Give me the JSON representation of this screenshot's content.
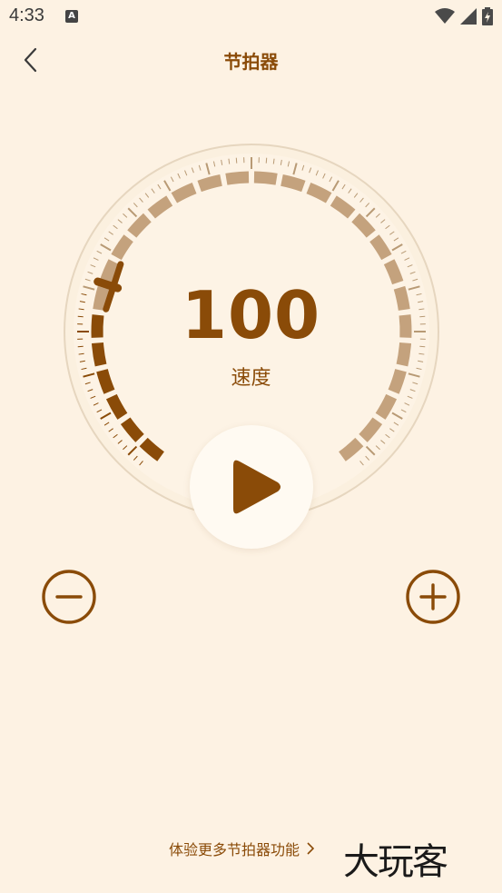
{
  "status": {
    "time": "4:33",
    "notification_icon": "A"
  },
  "header": {
    "title": "节拍器",
    "back_icon": "chevron-left-icon"
  },
  "metronome": {
    "bpm": "100",
    "label": "速度",
    "play_icon": "play-icon",
    "decrease_icon": "minus-circle-icon",
    "increase_icon": "plus-circle-icon"
  },
  "footer": {
    "more_link": "体验更多节拍器功能",
    "logo": "大玩客"
  },
  "colors": {
    "accent": "#8a4b08",
    "light_segment": "#c4a27d",
    "background": "#fdf2e3"
  }
}
